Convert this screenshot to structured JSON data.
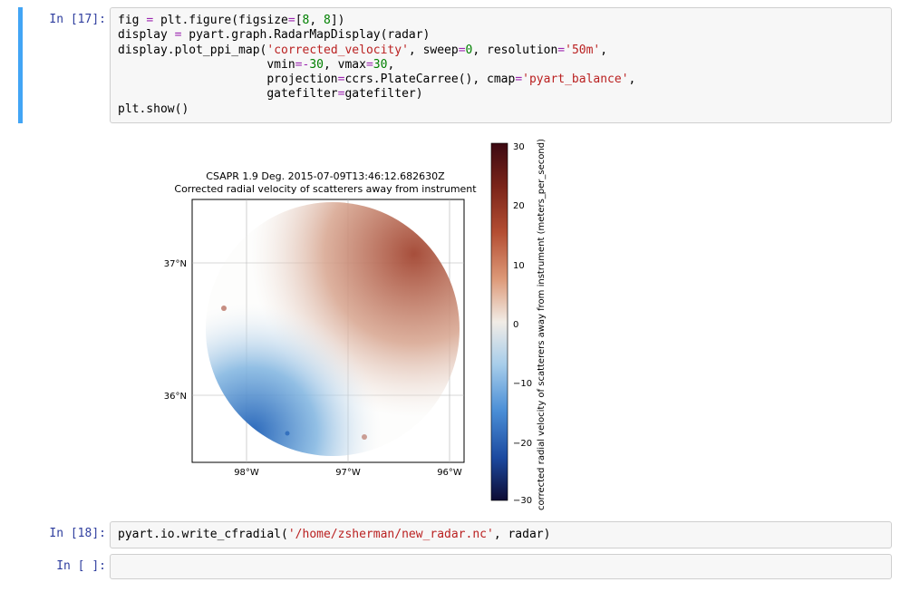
{
  "cells": [
    {
      "prompt": "In [17]:",
      "code_html": "fig <span class=\"c-op\">=</span> plt.figure(figsize<span class=\"c-op\">=</span>[<span class=\"c-num\">8</span>, <span class=\"c-num\">8</span>])\ndisplay <span class=\"c-op\">=</span> pyart.graph.RadarMapDisplay(radar)\ndisplay.plot_ppi_map(<span class=\"c-str\">'corrected_velocity'</span>, sweep<span class=\"c-op\">=</span><span class=\"c-num\">0</span>, resolution<span class=\"c-op\">=</span><span class=\"c-str\">'50m'</span>,\n                     vmin<span class=\"c-op\">=-</span><span class=\"c-num\">30</span>, vmax<span class=\"c-op\">=</span><span class=\"c-num\">30</span>,\n                     projection<span class=\"c-op\">=</span>ccrs.PlateCarree(), cmap<span class=\"c-op\">=</span><span class=\"c-str\">'pyart_balance'</span>,\n                     gatefilter<span class=\"c-op\">=</span>gatefilter)\nplt.show()"
    },
    {
      "prompt": "In [18]:",
      "code_html": "pyart.io.write_cfradial(<span class=\"c-str\">'/home/zsherman/new_radar.nc'</span>, radar)"
    },
    {
      "prompt": "In [ ]:",
      "code_html": ""
    }
  ],
  "chart_data": {
    "type": "heatmap",
    "title_line1": "CSAPR 1.9 Deg. 2015-07-09T13:46:12.682630Z",
    "title_line2": "Corrected radial velocity of scatterers away from instrument",
    "x_ticks": [
      "98°W",
      "97°W",
      "96°W"
    ],
    "y_ticks": [
      "37°N",
      "36°N"
    ],
    "xlim": [
      "98.5°W",
      "95.8°W"
    ],
    "ylim": [
      "35.5°N",
      "37.5°N"
    ],
    "colorbar": {
      "label": "corrected radial velocity of scatterers away from instrument (meters_per_second)",
      "ticks": [
        30,
        20,
        10,
        0,
        -10,
        -20,
        -30
      ],
      "vmin": -30,
      "vmax": 30,
      "cmap": "pyart_balance"
    }
  }
}
